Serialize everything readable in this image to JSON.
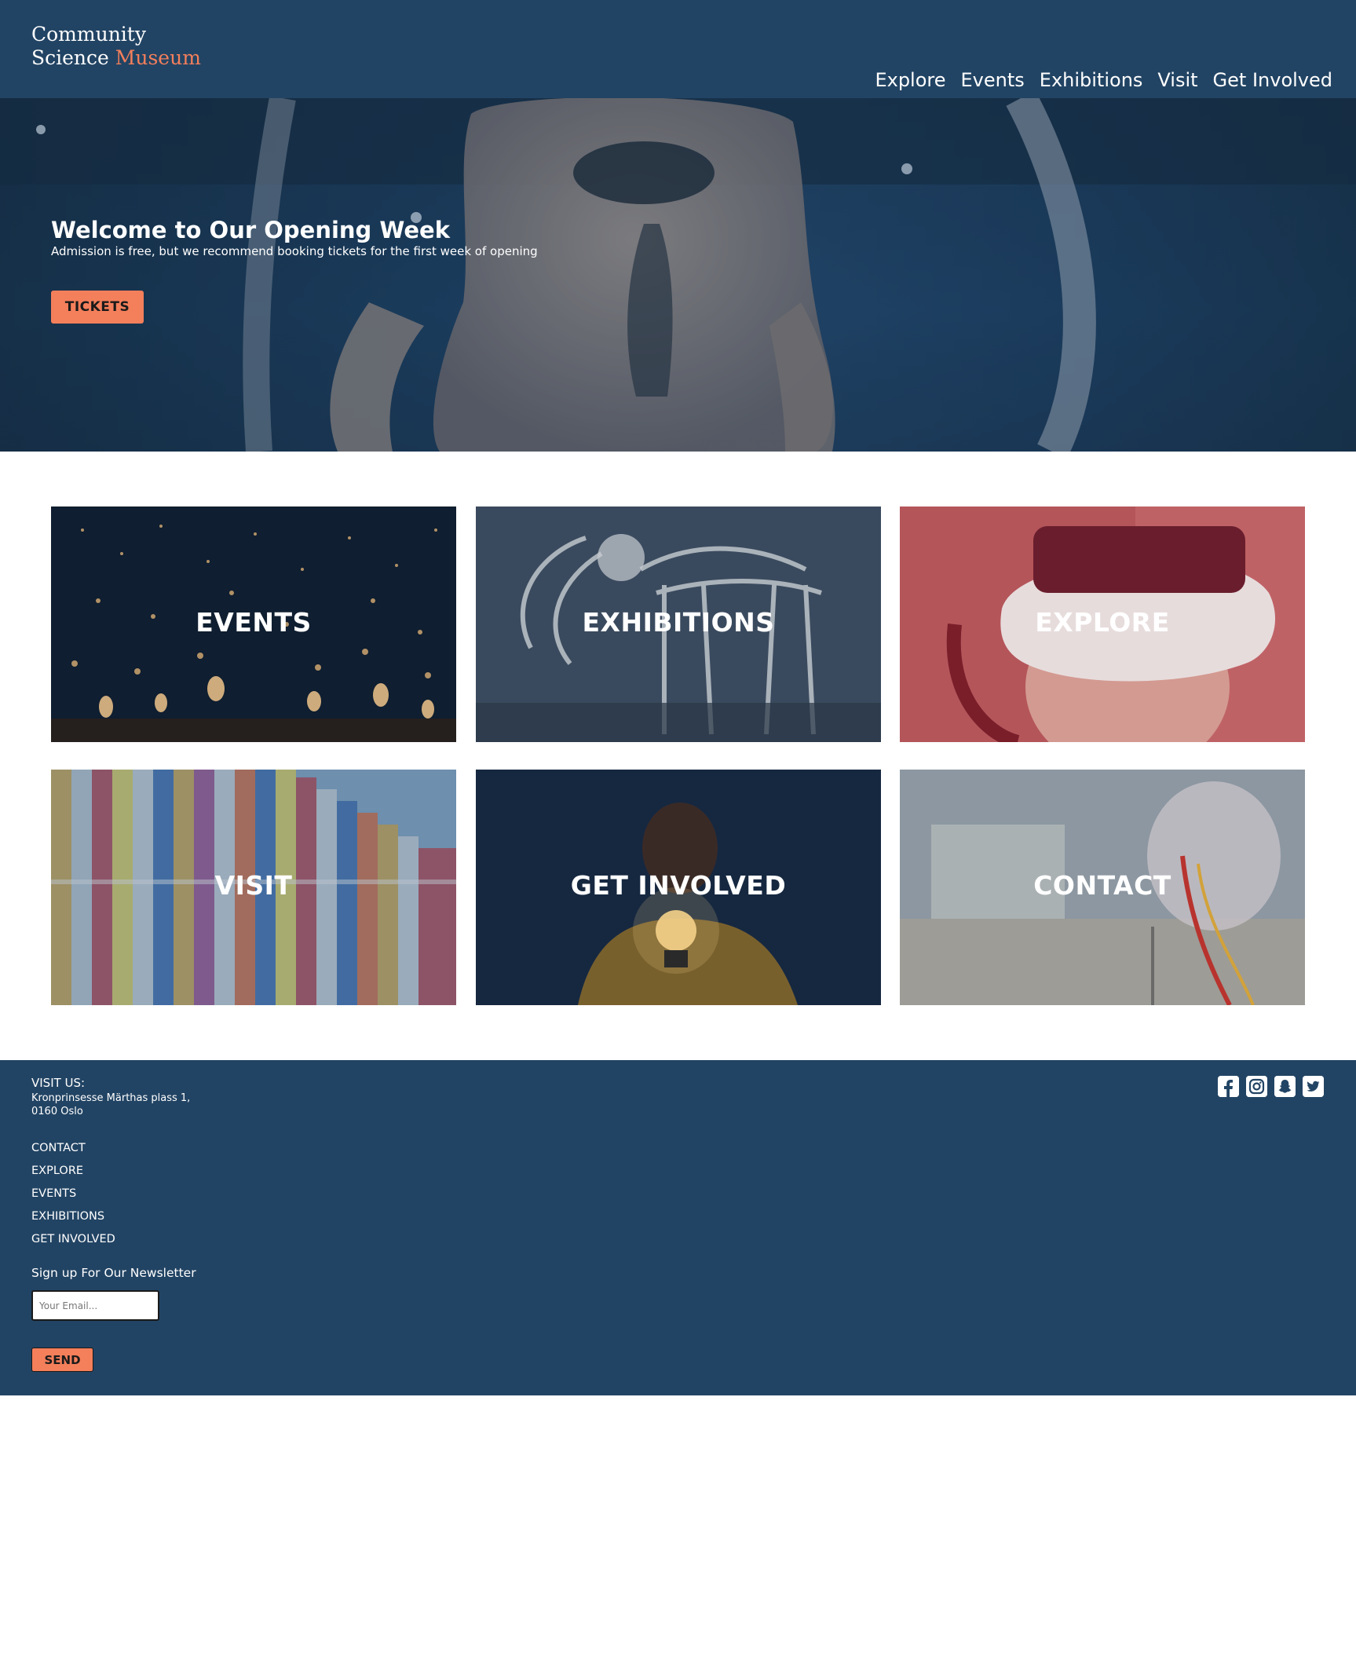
{
  "header": {
    "logo_line1": "Community",
    "logo_line2_prefix": "Science ",
    "logo_line2_accent": "Museum",
    "nav": [
      {
        "label": "Explore"
      },
      {
        "label": "Events"
      },
      {
        "label": "Exhibitions"
      },
      {
        "label": "Visit"
      },
      {
        "label": "Get Involved"
      }
    ]
  },
  "hero": {
    "title": "Welcome to Our Opening Week",
    "subtitle": "Admission is free, but we recommend booking tickets for the first week of opening",
    "button_label": "TICKETS"
  },
  "tiles": [
    {
      "label": "EVENTS"
    },
    {
      "label": "EXHIBITIONS"
    },
    {
      "label": "EXPLORE"
    },
    {
      "label": "VISIT"
    },
    {
      "label": "GET INVOLVED"
    },
    {
      "label": "CONTACT"
    }
  ],
  "footer": {
    "visit_heading": "VISIT US:",
    "address_line1": "Kronprinsesse Märthas plass 1,",
    "address_line2": "0160 Oslo",
    "links": [
      {
        "label": "CONTACT"
      },
      {
        "label": "EXPLORE"
      },
      {
        "label": "EVENTS"
      },
      {
        "label": "EXHIBITIONS"
      },
      {
        "label": "GET INVOLVED"
      }
    ],
    "newsletter_label": "Sign up For Our Newsletter",
    "email_placeholder": "Your Email...",
    "send_label": "SEND",
    "social_icons": [
      "facebook-icon",
      "instagram-icon",
      "snapchat-icon",
      "twitter-icon"
    ]
  },
  "colors": {
    "navy": "#224464",
    "accent": "#f47f5b",
    "white": "#ffffff"
  }
}
